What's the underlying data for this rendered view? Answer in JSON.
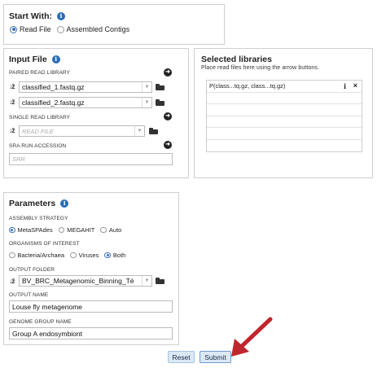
{
  "start_with": {
    "title": "Start With:",
    "options": [
      "Read File",
      "Assembled Contigs"
    ],
    "selected": "Read File"
  },
  "input_file": {
    "title": "Input File",
    "paired_label": "PAIRED READ LIBRARY",
    "paired_read_1": "classified_1.fastq.gz",
    "paired_read_2": "classified_2.fastq.gz",
    "single_label": "SINGLE READ LIBRARY",
    "single_placeholder": "READ FILE",
    "sra_label": "SRA RUN ACCESSION",
    "sra_placeholder": "SRR"
  },
  "selected_libraries": {
    "title": "Selected libraries",
    "hint": "Place read files here using the arrow buttons.",
    "items": [
      "P(class...tq.gz, class...tq.gz)"
    ]
  },
  "parameters": {
    "title": "Parameters",
    "assembly_label": "ASSEMBLY STRATEGY",
    "assembly_options": [
      "MetaSPAdes",
      "MEGAHIT",
      "Auto"
    ],
    "assembly_selected": "MetaSPAdes",
    "organisms_label": "ORGANISMS OF INTEREST",
    "organisms_options": [
      "Bacteria/Archaea",
      "Viruses",
      "Both"
    ],
    "organisms_selected": "Both",
    "output_folder_label": "OUTPUT FOLDER",
    "output_folder_value": "BV_BRC_Metagenomic_Binning_Té",
    "output_name_label": "OUTPUT NAME",
    "output_name_value": "Louse fly metagenome",
    "genome_group_label": "GENOME GROUP NAME",
    "genome_group_value": "Group A endosymbiont"
  },
  "actions": {
    "reset_label": "Reset",
    "submit_label": "Submit"
  },
  "annotation": {
    "arrow_color": "#c0262d"
  }
}
